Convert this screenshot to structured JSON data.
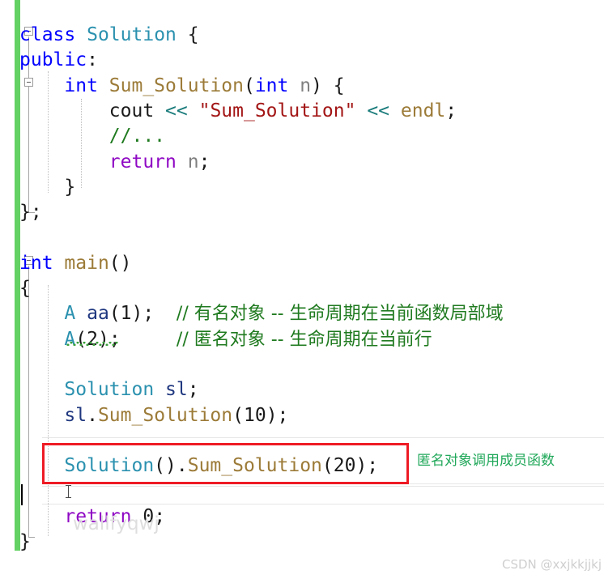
{
  "editor": {
    "language": "C++",
    "colors": {
      "keyword": "#0000ff",
      "control_keyword": "#8f08c4",
      "user_type": "#2b91af",
      "function": "#9c7b38",
      "string": "#a31515",
      "comment": "#1f7a1f",
      "operator": "#1a7b7b",
      "local_variable": "#1f377f",
      "parameter": "#808080",
      "plain_text": "#1a1a1a",
      "change_bar_saved": "#63d163",
      "annotation_box": "#ee1b24",
      "annotation_text": "#21a85a",
      "error_squiggle": "#3aa03a"
    },
    "lines": [
      {
        "n": 1,
        "tokens": [
          {
            "t": "class",
            "c": "kw"
          },
          {
            "t": " ",
            "c": "plain"
          },
          {
            "t": "Solution",
            "c": "type"
          },
          {
            "t": " {",
            "c": "plain"
          }
        ]
      },
      {
        "n": 2,
        "tokens": [
          {
            "t": "public",
            "c": "kw"
          },
          {
            "t": ":",
            "c": "plain"
          }
        ]
      },
      {
        "n": 3,
        "tokens": [
          {
            "t": "    ",
            "c": "plain"
          },
          {
            "t": "int",
            "c": "kw"
          },
          {
            "t": " ",
            "c": "plain"
          },
          {
            "t": "Sum_Solution",
            "c": "fn"
          },
          {
            "t": "(",
            "c": "plain"
          },
          {
            "t": "int",
            "c": "kw"
          },
          {
            "t": " ",
            "c": "plain"
          },
          {
            "t": "n",
            "c": "param"
          },
          {
            "t": ") {",
            "c": "plain"
          }
        ]
      },
      {
        "n": 4,
        "tokens": [
          {
            "t": "        ",
            "c": "plain"
          },
          {
            "t": "cout",
            "c": "plain"
          },
          {
            "t": " ",
            "c": "plain"
          },
          {
            "t": "<<",
            "c": "op"
          },
          {
            "t": " ",
            "c": "plain"
          },
          {
            "t": "\"Sum_Solution\"",
            "c": "str"
          },
          {
            "t": " ",
            "c": "plain"
          },
          {
            "t": "<<",
            "c": "op"
          },
          {
            "t": " ",
            "c": "plain"
          },
          {
            "t": "endl",
            "c": "fn"
          },
          {
            "t": ";",
            "c": "plain"
          }
        ]
      },
      {
        "n": 5,
        "tokens": [
          {
            "t": "        ",
            "c": "plain"
          },
          {
            "t": "//...",
            "c": "cmt"
          }
        ]
      },
      {
        "n": 6,
        "tokens": [
          {
            "t": "        ",
            "c": "plain"
          },
          {
            "t": "return",
            "c": "ctrl"
          },
          {
            "t": " ",
            "c": "plain"
          },
          {
            "t": "n",
            "c": "param"
          },
          {
            "t": ";",
            "c": "plain"
          }
        ]
      },
      {
        "n": 7,
        "tokens": [
          {
            "t": "    }",
            "c": "plain"
          }
        ]
      },
      {
        "n": 8,
        "tokens": [
          {
            "t": "};",
            "c": "plain"
          }
        ]
      },
      {
        "n": 9,
        "tokens": []
      },
      {
        "n": 10,
        "tokens": [
          {
            "t": "int",
            "c": "kw"
          },
          {
            "t": " ",
            "c": "plain"
          },
          {
            "t": "main",
            "c": "fn"
          },
          {
            "t": "()",
            "c": "plain"
          }
        ]
      },
      {
        "n": 11,
        "tokens": [
          {
            "t": "{",
            "c": "plain"
          }
        ]
      },
      {
        "n": 12,
        "tokens": [
          {
            "t": "    ",
            "c": "plain"
          },
          {
            "t": "A",
            "c": "type"
          },
          {
            "t": " ",
            "c": "plain"
          },
          {
            "t": "aa",
            "c": "var"
          },
          {
            "t": "(",
            "c": "plain"
          },
          {
            "t": "1",
            "c": "num"
          },
          {
            "t": ");  ",
            "c": "plain"
          },
          {
            "t": "// 有名对象 -- 生命周期在当前函数局部域",
            "c": "cmt cjk"
          }
        ]
      },
      {
        "n": 13,
        "tokens": [
          {
            "t": "    ",
            "c": "plain"
          },
          {
            "t": "A",
            "c": "type"
          },
          {
            "t": "(",
            "c": "plain"
          },
          {
            "t": "2",
            "c": "num"
          },
          {
            "t": ");     ",
            "c": "plain"
          },
          {
            "t": "// 匿名对象 -- 生命周期在当前行",
            "c": "cmt cjk"
          }
        ]
      },
      {
        "n": 14,
        "tokens": []
      },
      {
        "n": 15,
        "tokens": [
          {
            "t": "    ",
            "c": "plain"
          },
          {
            "t": "Solution",
            "c": "type"
          },
          {
            "t": " ",
            "c": "plain"
          },
          {
            "t": "sl",
            "c": "var"
          },
          {
            "t": ";",
            "c": "plain"
          }
        ]
      },
      {
        "n": 16,
        "tokens": [
          {
            "t": "    ",
            "c": "plain"
          },
          {
            "t": "sl",
            "c": "var"
          },
          {
            "t": ".",
            "c": "plain"
          },
          {
            "t": "Sum_Solution",
            "c": "fn"
          },
          {
            "t": "(",
            "c": "plain"
          },
          {
            "t": "10",
            "c": "num"
          },
          {
            "t": ");",
            "c": "plain"
          }
        ]
      },
      {
        "n": 17,
        "tokens": []
      },
      {
        "n": 18,
        "tokens": [
          {
            "t": "    ",
            "c": "plain"
          },
          {
            "t": "Solution",
            "c": "type"
          },
          {
            "t": "().",
            "c": "plain"
          },
          {
            "t": "Sum_Solution",
            "c": "fn"
          },
          {
            "t": "(",
            "c": "plain"
          },
          {
            "t": "20",
            "c": "num"
          },
          {
            "t": ");",
            "c": "plain"
          }
        ]
      },
      {
        "n": 19,
        "tokens": []
      },
      {
        "n": 20,
        "tokens": [
          {
            "t": "    ",
            "c": "plain"
          },
          {
            "t": "return",
            "c": "ctrl"
          },
          {
            "t": " ",
            "c": "plain"
          },
          {
            "t": "0",
            "c": "num"
          },
          {
            "t": ";",
            "c": "plain"
          }
        ]
      },
      {
        "n": 21,
        "tokens": [
          {
            "t": "}",
            "c": "plain"
          }
        ]
      }
    ]
  },
  "annotations": {
    "highlight_box_target": "Solution().Sum_Solution(20);",
    "label": "匿名对象调用成员函数"
  },
  "watermarks": {
    "inline": "wallfyqwj",
    "corner": "CSDN @xxjkkjjkj"
  }
}
